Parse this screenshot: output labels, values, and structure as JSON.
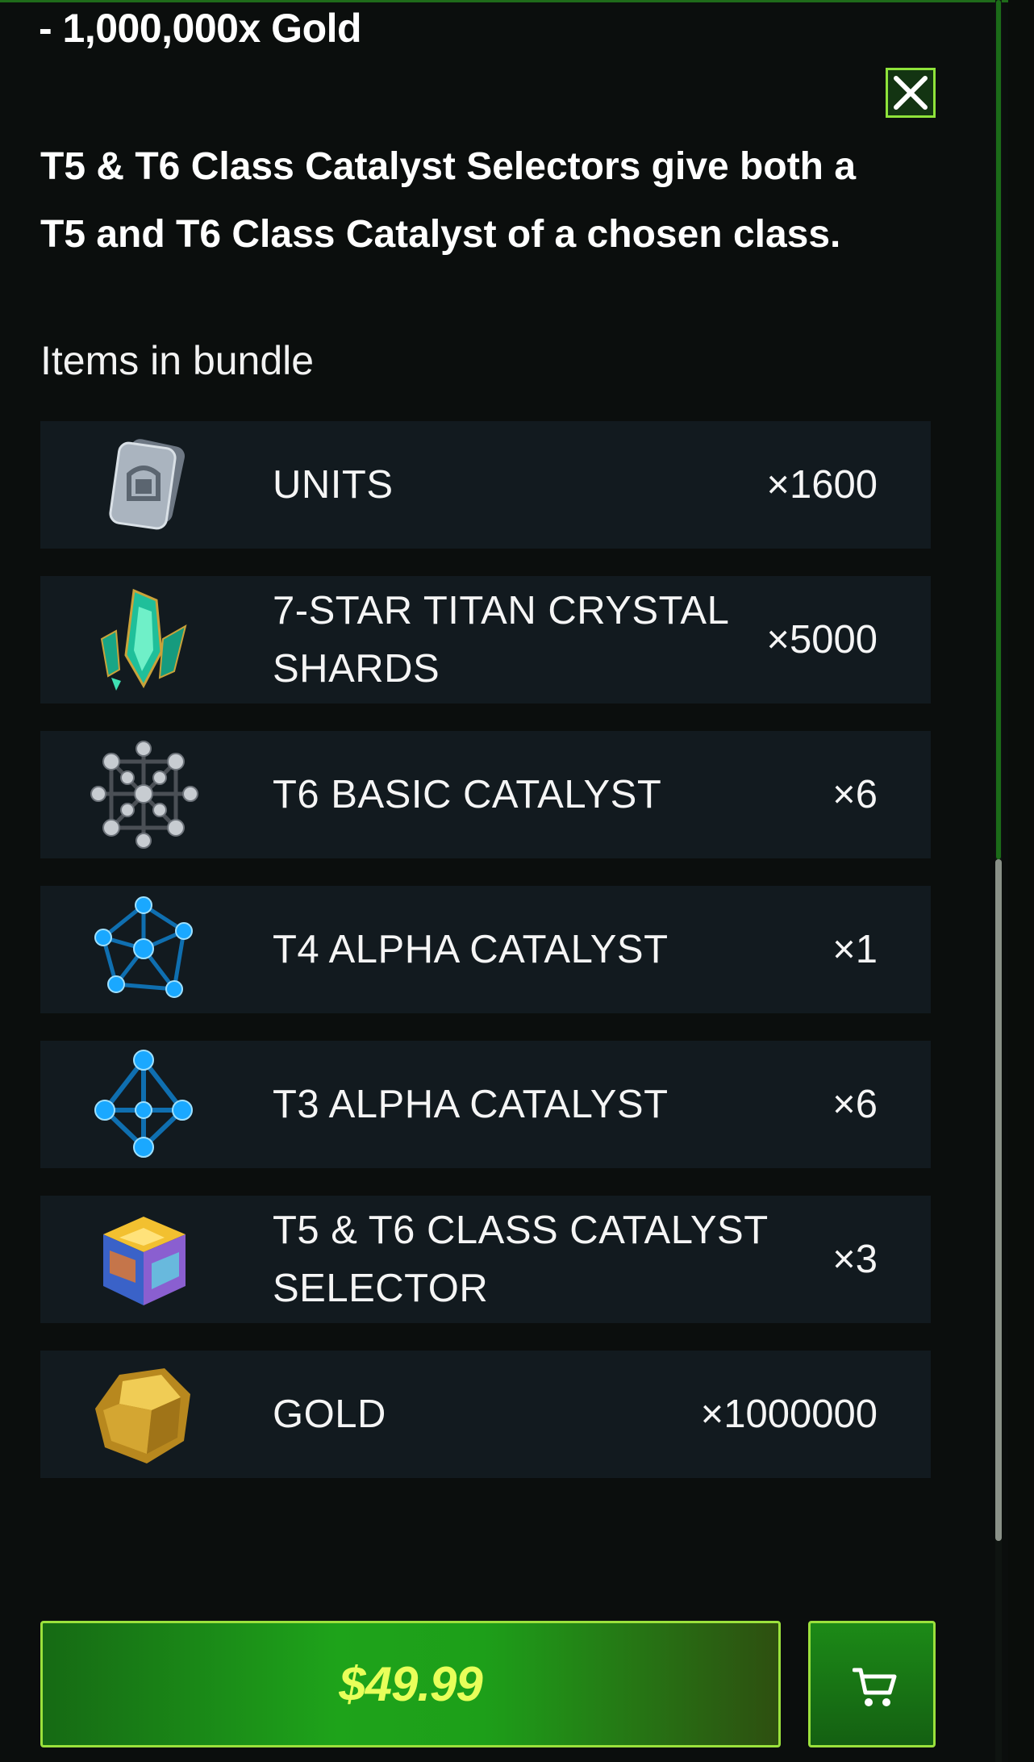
{
  "header": {
    "gold_line": "- 1,000,000x Gold",
    "close_label": "close"
  },
  "description": "T5 & T6 Class Catalyst Selectors give both a T5 and T6 Class Catalyst of a chosen class.",
  "items_heading": "Items in bundle",
  "items": [
    {
      "name": "UNITS",
      "qty": "×1600",
      "icon": "units-icon"
    },
    {
      "name": "7-STAR TITAN CRYSTAL SHARDS",
      "qty": "×5000",
      "icon": "titan-crystal-shards-icon"
    },
    {
      "name": "T6 BASIC CATALYST",
      "qty": "×6",
      "icon": "t6-basic-catalyst-icon"
    },
    {
      "name": "T4 ALPHA CATALYST",
      "qty": "×1",
      "icon": "t4-alpha-catalyst-icon"
    },
    {
      "name": "T3 ALPHA CATALYST",
      "qty": "×6",
      "icon": "t3-alpha-catalyst-icon"
    },
    {
      "name": "T5 & T6 CLASS CATALYST SELECTOR",
      "qty": "×3",
      "icon": "class-catalyst-selector-icon"
    },
    {
      "name": "GOLD",
      "qty": "×1000000",
      "icon": "gold-icon"
    }
  ],
  "purchase": {
    "price": "$49.99",
    "cart_icon": "cart-icon"
  },
  "colors": {
    "background": "#0b0e0d",
    "row_bg": "#121a1f",
    "accent_green": "#9be13c",
    "price_text": "#e8ff5a"
  }
}
